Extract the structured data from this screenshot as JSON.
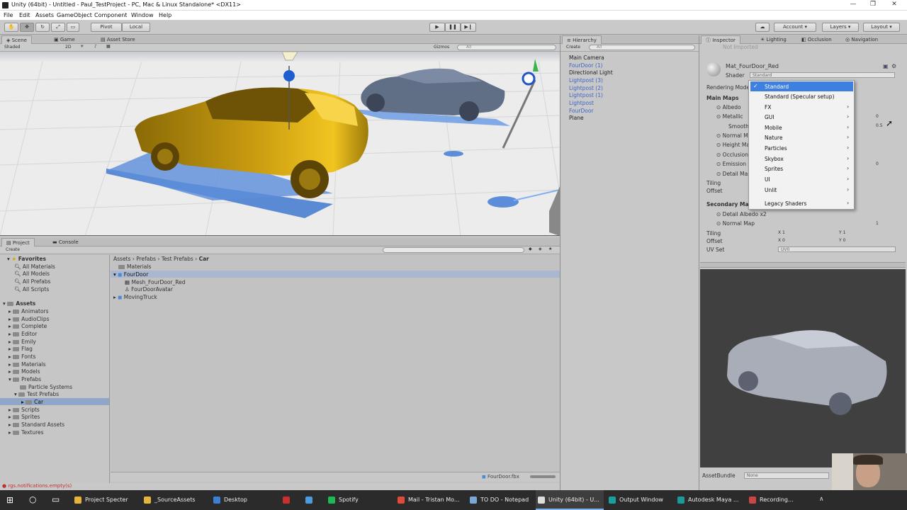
{
  "window": {
    "title": "Unity (64bit) - Untitled - Paul_TestProject - PC, Mac & Linux Standalone* <DX11>"
  },
  "menubar": {
    "items": [
      "File",
      "Edit",
      "Assets",
      "GameObject",
      "Component",
      "Window",
      "Help"
    ]
  },
  "toolbar": {
    "pivot": "Pivot",
    "local": "Local",
    "account": "Account",
    "layers": "Layers",
    "layout": "Layout"
  },
  "scene_panel": {
    "tabs": [
      "Scene",
      "Game",
      "Asset Store"
    ],
    "shading": "Shaded",
    "mode_2d": "2D",
    "gizmos": "Gizmos",
    "search": "All"
  },
  "hierarchy": {
    "tab": "Hierarchy",
    "create": "Create",
    "search": "All",
    "items": [
      {
        "label": "Main Camera",
        "prefab": false
      },
      {
        "label": "FourDoor (1)",
        "prefab": true
      },
      {
        "label": "Directional Light",
        "prefab": false
      },
      {
        "label": "Lightpost (3)",
        "prefab": true
      },
      {
        "label": "Lightpost (2)",
        "prefab": true
      },
      {
        "label": "Lightpost (1)",
        "prefab": true
      },
      {
        "label": "Lightpost",
        "prefab": true
      },
      {
        "label": "FourDoor",
        "prefab": true
      },
      {
        "label": "Plane",
        "prefab": false
      }
    ]
  },
  "inspector": {
    "tabs": [
      "Inspector",
      "Lighting",
      "Occlusion",
      "Navigation"
    ],
    "header_faded": "Not Imported",
    "material_name": "Mat_FourDoor_Red",
    "shader_label": "Shader",
    "shader_value": "Standard",
    "rendering_mode": "Rendering Mode",
    "main_maps": "Main Maps",
    "props": [
      "Albedo",
      "Metallic",
      "Smoothness",
      "Normal Map",
      "Height Map",
      "Occlusion",
      "Emission",
      "Detail Mask"
    ],
    "metallic_value": "0",
    "smooth_value": "0.5",
    "emission_value": "0",
    "tiling": "Tiling",
    "offset": "Offset",
    "secondary_maps": "Secondary Maps",
    "detail_albedo": "Detail Albedo x2",
    "normal_map2": "Normal Map",
    "normal_map2_value": "1",
    "tiling2": "Tiling",
    "offset2": "Offset",
    "tiling2_x": "1",
    "tiling2_y": "1",
    "offset2_x": "0",
    "offset2_y": "0",
    "x_label": "X",
    "y_label": "Y",
    "uvset": "UV Set",
    "uvset_value": "UV0",
    "assetbundle": "AssetBundle",
    "assetbundle_value": "None"
  },
  "shader_menu": {
    "items": [
      {
        "label": "Standard",
        "checked": true,
        "submenu": false
      },
      {
        "label": "Standard (Specular setup)",
        "checked": false,
        "submenu": false
      },
      {
        "label": "FX",
        "checked": false,
        "submenu": true
      },
      {
        "label": "GUI",
        "checked": false,
        "submenu": true
      },
      {
        "label": "Mobile",
        "checked": false,
        "submenu": true
      },
      {
        "label": "Nature",
        "checked": false,
        "submenu": true
      },
      {
        "label": "Particles",
        "checked": false,
        "submenu": true
      },
      {
        "label": "Skybox",
        "checked": false,
        "submenu": true
      },
      {
        "label": "Sprites",
        "checked": false,
        "submenu": true
      },
      {
        "label": "UI",
        "checked": false,
        "submenu": true
      },
      {
        "label": "Unlit",
        "checked": false,
        "submenu": true
      },
      {
        "label": "Legacy Shaders",
        "checked": false,
        "submenu": true
      }
    ]
  },
  "project": {
    "tabs": [
      "Project",
      "Console"
    ],
    "create": "Create",
    "favorites_label": "Favorites",
    "favorites": [
      "All Materials",
      "All Models",
      "All Prefabs",
      "All Scripts"
    ],
    "assets_label": "Assets",
    "assets": [
      "Animators",
      "AudioClips",
      "Complete",
      "Editor",
      "Emily",
      "Flag",
      "Fonts",
      "Materials",
      "Models",
      "Prefabs"
    ],
    "prefab_children": [
      "Particle Systems",
      "Test Prefabs"
    ],
    "car_folder": "Car",
    "assets_after": [
      "Scripts",
      "Sprites",
      "Standard Assets",
      "Textures"
    ],
    "breadcrumb": [
      "Assets",
      "Prefabs",
      "Test Prefabs",
      "Car"
    ],
    "breadcrumb_sep": "›",
    "files": [
      "Materials",
      "FourDoor",
      "Mesh_FourDoor_Red",
      "FourDoorAvatar",
      "MovingTruck"
    ],
    "status_file": "FourDoor.fbx"
  },
  "statusbar": {
    "error": "rgs.notifications.empty(s)"
  },
  "taskbar": {
    "items": [
      {
        "label": "Project Specter",
        "color": "#e8b33a"
      },
      {
        "label": "_SourceAssets",
        "color": "#e8b33a"
      },
      {
        "label": "Desktop",
        "color": "#3c7fd8"
      },
      {
        "label": "",
        "color": "#c8302f"
      },
      {
        "label": "",
        "color": "#4a9be0"
      },
      {
        "label": "Spotify",
        "color": "#1db954"
      },
      {
        "label": "Mail - Tristan Mo...",
        "color": "#e04a3a"
      },
      {
        "label": "TO DO - Notepad",
        "color": "#7aa7d8"
      },
      {
        "label": "Unity (64bit) - U...",
        "color": "#dddddd"
      },
      {
        "label": "Output Window",
        "color": "#18a0a0"
      },
      {
        "label": "Autodesk Maya ...",
        "color": "#1b9a9a"
      },
      {
        "label": "Recording...",
        "color": "#c44"
      }
    ]
  }
}
